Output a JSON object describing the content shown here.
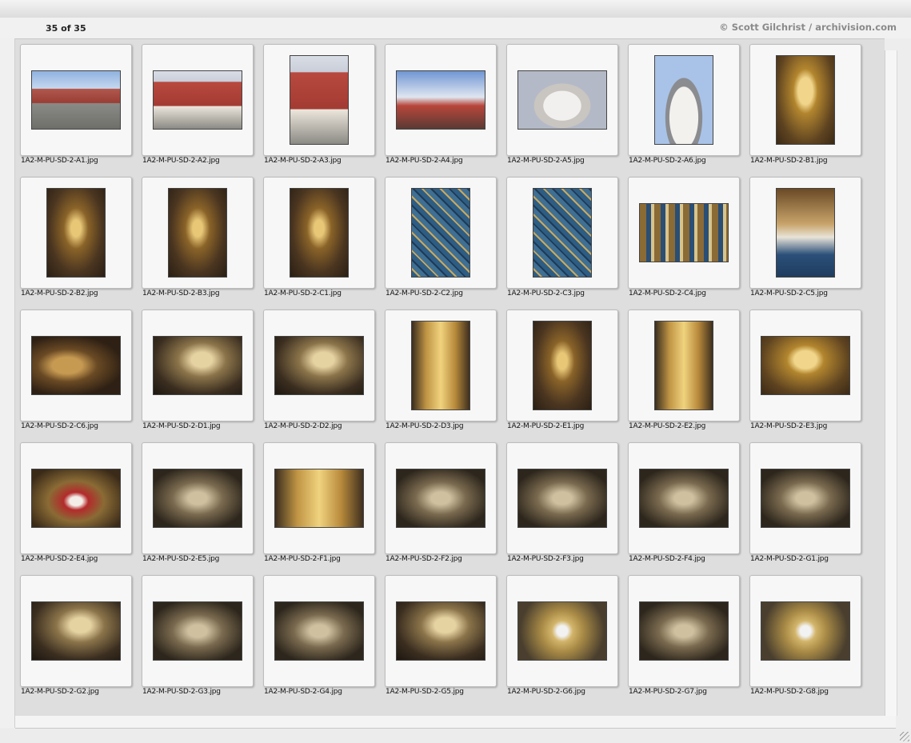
{
  "header": {
    "count": "35 of 35",
    "credit": "© Scott Gilchrist / archivision.com"
  },
  "thumbnails": [
    {
      "label": "1A2-M-PU-SD-2-A1.jpg",
      "orientation": "landscape",
      "style": "t-plaza"
    },
    {
      "label": "1A2-M-PU-SD-2-A2.jpg",
      "orientation": "landscape",
      "style": "t-church"
    },
    {
      "label": "1A2-M-PU-SD-2-A3.jpg",
      "orientation": "portrait",
      "style": "t-church"
    },
    {
      "label": "1A2-M-PU-SD-2-A4.jpg",
      "orientation": "landscape",
      "style": "t-skyred"
    },
    {
      "label": "1A2-M-PU-SD-2-A5.jpg",
      "orientation": "landscape",
      "style": "t-dome"
    },
    {
      "label": "1A2-M-PU-SD-2-A6.jpg",
      "orientation": "portrait",
      "style": "t-domesky"
    },
    {
      "label": "1A2-M-PU-SD-2-B1.jpg",
      "orientation": "portrait",
      "style": "t-gold"
    },
    {
      "label": "1A2-M-PU-SD-2-B2.jpg",
      "orientation": "portrait",
      "style": "t-nave"
    },
    {
      "label": "1A2-M-PU-SD-2-B3.jpg",
      "orientation": "portrait",
      "style": "t-nave"
    },
    {
      "label": "1A2-M-PU-SD-2-C1.jpg",
      "orientation": "portrait",
      "style": "t-nave"
    },
    {
      "label": "1A2-M-PU-SD-2-C2.jpg",
      "orientation": "portrait",
      "style": "t-tile"
    },
    {
      "label": "1A2-M-PU-SD-2-C3.jpg",
      "orientation": "portrait",
      "style": "t-tile"
    },
    {
      "label": "1A2-M-PU-SD-2-C4.jpg",
      "orientation": "landscape",
      "style": "t-tilewide"
    },
    {
      "label": "1A2-M-PU-SD-2-C5.jpg",
      "orientation": "portrait",
      "style": "t-tiletop"
    },
    {
      "label": "1A2-M-PU-SD-2-C6.jpg",
      "orientation": "landscape",
      "style": "t-scroll"
    },
    {
      "label": "1A2-M-PU-SD-2-D1.jpg",
      "orientation": "landscape",
      "style": "t-vault"
    },
    {
      "label": "1A2-M-PU-SD-2-D2.jpg",
      "orientation": "landscape",
      "style": "t-vault"
    },
    {
      "label": "1A2-M-PU-SD-2-D3.jpg",
      "orientation": "portrait",
      "style": "t-altar"
    },
    {
      "label": "1A2-M-PU-SD-2-E1.jpg",
      "orientation": "portrait",
      "style": "t-nave"
    },
    {
      "label": "1A2-M-PU-SD-2-E2.jpg",
      "orientation": "portrait",
      "style": "t-altar"
    },
    {
      "label": "1A2-M-PU-SD-2-E3.jpg",
      "orientation": "landscape",
      "style": "t-gold"
    },
    {
      "label": "1A2-M-PU-SD-2-E4.jpg",
      "orientation": "landscape",
      "style": "t-virgin"
    },
    {
      "label": "1A2-M-PU-SD-2-E5.jpg",
      "orientation": "landscape",
      "style": "t-dark"
    },
    {
      "label": "1A2-M-PU-SD-2-F1.jpg",
      "orientation": "landscape",
      "style": "t-altar"
    },
    {
      "label": "1A2-M-PU-SD-2-F2.jpg",
      "orientation": "landscape",
      "style": "t-dark"
    },
    {
      "label": "1A2-M-PU-SD-2-F3.jpg",
      "orientation": "landscape",
      "style": "t-dark"
    },
    {
      "label": "1A2-M-PU-SD-2-F4.jpg",
      "orientation": "landscape",
      "style": "t-dark"
    },
    {
      "label": "1A2-M-PU-SD-2-G1.jpg",
      "orientation": "landscape",
      "style": "t-dark"
    },
    {
      "label": "1A2-M-PU-SD-2-G2.jpg",
      "orientation": "landscape",
      "style": "t-vault"
    },
    {
      "label": "1A2-M-PU-SD-2-G3.jpg",
      "orientation": "landscape",
      "style": "t-dark"
    },
    {
      "label": "1A2-M-PU-SD-2-G4.jpg",
      "orientation": "landscape",
      "style": "t-dark"
    },
    {
      "label": "1A2-M-PU-SD-2-G5.jpg",
      "orientation": "landscape",
      "style": "t-vault"
    },
    {
      "label": "1A2-M-PU-SD-2-G6.jpg",
      "orientation": "landscape",
      "style": "t-sun"
    },
    {
      "label": "1A2-M-PU-SD-2-G7.jpg",
      "orientation": "landscape",
      "style": "t-dark"
    },
    {
      "label": "1A2-M-PU-SD-2-G8.jpg",
      "orientation": "landscape",
      "style": "t-sun"
    }
  ]
}
